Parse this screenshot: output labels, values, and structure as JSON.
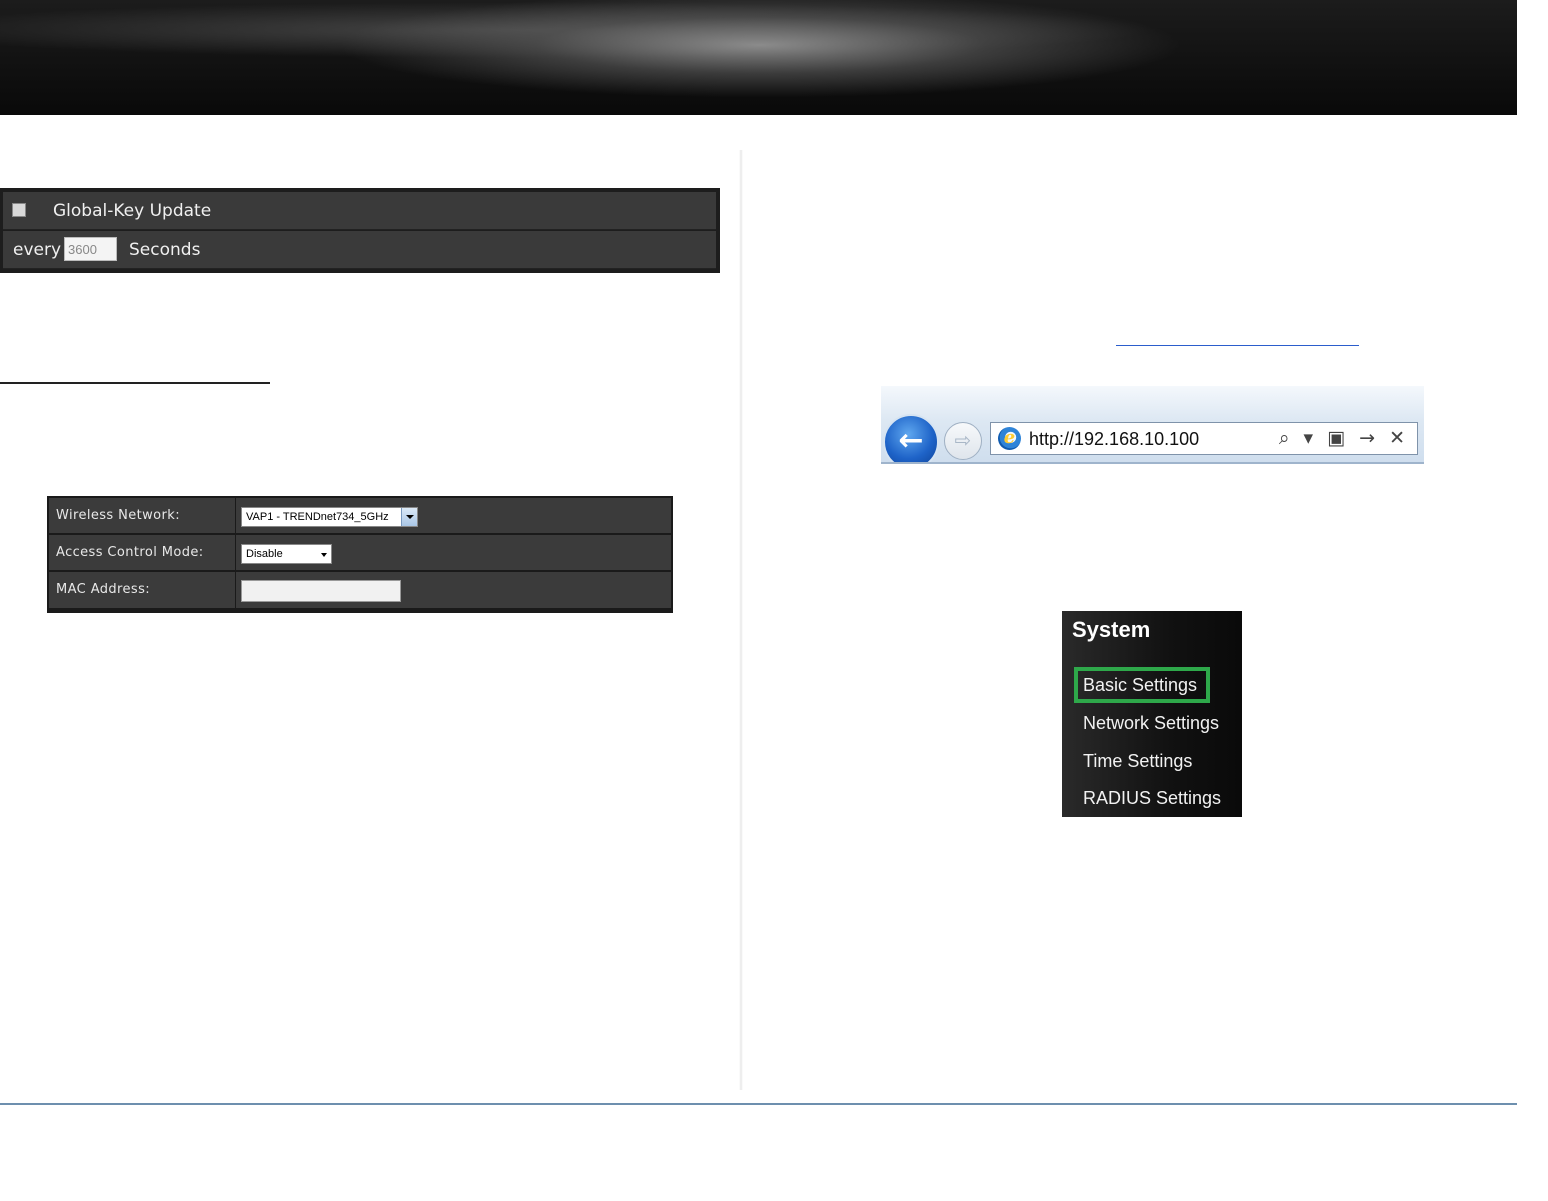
{
  "global_key": {
    "label": "Global-Key Update",
    "every_label": "every",
    "interval_value": "3600",
    "seconds_label": "Seconds"
  },
  "access_control": {
    "wireless_network_label": "Wireless Network:",
    "wireless_network_value": "VAP1 - TRENDnet734_5GHz",
    "mode_label": "Access Control Mode:",
    "mode_value": "Disable",
    "mac_label": "MAC Address:",
    "mac_value": ""
  },
  "browser": {
    "url": "http://192.168.10.100",
    "tools": "⌕ ▾ ▣ → ✕"
  },
  "system_menu": {
    "title": "System",
    "items": [
      "Basic Settings",
      "Network Settings",
      "Time Settings",
      "RADIUS Settings"
    ],
    "highlighted": "Basic Settings",
    "highlight_color": "#2ea84a"
  }
}
